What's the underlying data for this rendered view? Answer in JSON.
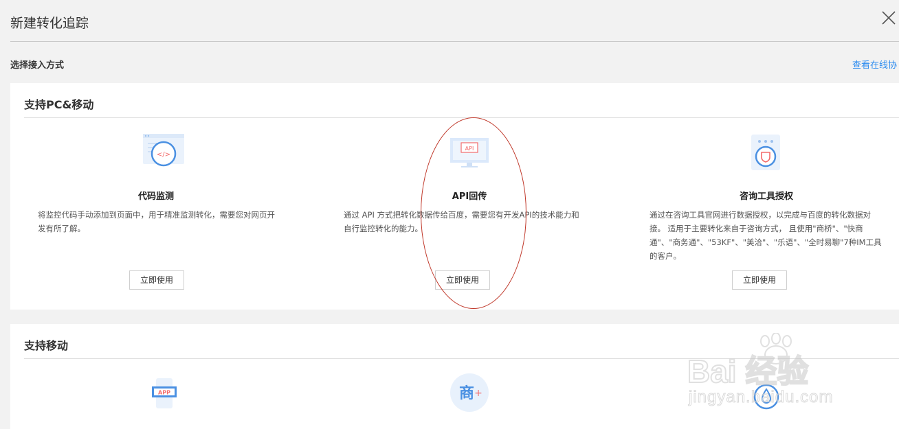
{
  "dialog": {
    "title": "新建转化追踪"
  },
  "header": {
    "section_label": "选择接入方式",
    "help_link": "查看在线协"
  },
  "panels": [
    {
      "title": "支持PC&移动",
      "cards": [
        {
          "icon": "code-icon",
          "icon_text": "</>",
          "name": "代码监测",
          "desc_lines": [
            "将监控代码手动添加到页面中，用于精准监测转化，需要您对网页开",
            "发有所了解。"
          ],
          "button": "立即使用"
        },
        {
          "icon": "api-icon",
          "icon_text": "API",
          "name": "API回传",
          "desc_lines": [
            "通过 API 方式把转化数据传给百度，需要您有开发API的技术能力和",
            "自行监控转化的能力。"
          ],
          "button": "立即使用"
        },
        {
          "icon": "shield-icon",
          "name": "咨询工具授权",
          "desc_lines": [
            "通过在咨询工具官网进行数据授权，以完成与百度的转化数据对",
            "接。 适用于主要转化来自于咨询方式， 且使用\"商桥\"、\"快商",
            "通\"、\"商务通\"、\"53KF\"、\"美洽\"、\"乐语\"、\"全时易聊\"7种IM工具",
            "的客户。"
          ],
          "button": "立即使用"
        }
      ]
    },
    {
      "title": "支持移动",
      "cards": [
        {
          "icon": "app-icon",
          "icon_text": "APP"
        },
        {
          "icon": "shangqiao-icon",
          "icon_text": "商"
        },
        {
          "icon": "water-drop-icon"
        }
      ]
    }
  ],
  "watermark": {
    "brand": "Bai 经验",
    "url": "jingyan.baidu.com"
  },
  "colors": {
    "accent": "#2d8cf0",
    "icon_blue": "#4a90e2",
    "icon_red": "#f36b6b",
    "annotation_red": "#c0392b"
  }
}
